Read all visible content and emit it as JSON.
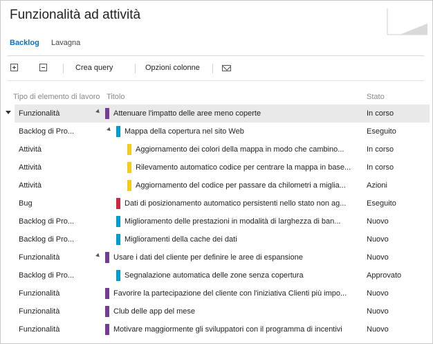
{
  "header": {
    "title": "Funzionalità ad attività"
  },
  "tabs": [
    {
      "label": "Backlog",
      "active": true
    },
    {
      "label": "Lavagna",
      "active": false
    }
  ],
  "toolbar": {
    "expand_icon": "expand-all-icon",
    "collapse_icon": "collapse-all-icon",
    "create_query": "Crea query",
    "column_options": "Opzioni colonne",
    "mail_icon": "mail-icon"
  },
  "columns": {
    "type": "Tipo di elemento di lavoro",
    "title": "Titolo",
    "state": "Stato"
  },
  "colors": {
    "feature": "#773b93",
    "pbi": "#009ccc",
    "task": "#f2cb1d",
    "bug": "#cc293d",
    "accent": "#106ebe"
  },
  "rows": [
    {
      "type": "Funzionalità",
      "title": "Attenuare l'impatto delle aree meno coperte",
      "state": "In corso",
      "kind": "feature",
      "level": 0,
      "expanded": true,
      "selected": true
    },
    {
      "type": "Backlog di Pro...",
      "title": "Mappa della copertura nel sito Web",
      "state": "Eseguito",
      "kind": "pbi",
      "level": 1,
      "expanded": true
    },
    {
      "type": "Attività",
      "title": "Aggiornamento dei colori della mappa in modo che cambino...",
      "state": "In corso",
      "kind": "task",
      "level": 2
    },
    {
      "type": "Attività",
      "title": "Rilevamento automatico codice per centrare la mappa in base...",
      "state": "In corso",
      "kind": "task",
      "level": 2
    },
    {
      "type": "Attività",
      "title": "Aggiornamento del codice per passare da chilometri a miglia...",
      "state": "Azioni",
      "kind": "task",
      "level": 2
    },
    {
      "type": "Bug",
      "title": "Dati di posizionamento automatico persistenti nello stato non ag...",
      "state": "Eseguito",
      "kind": "bug",
      "level": 1
    },
    {
      "type": "Backlog di Pro...",
      "title": "Miglioramento delle prestazioni in modalità di larghezza di ban...",
      "state": "Nuovo",
      "kind": "pbi",
      "level": 1
    },
    {
      "type": "Backlog di Pro...",
      "title": "Miglioramenti della cache dei dati",
      "state": "Nuovo",
      "kind": "pbi",
      "level": 1
    },
    {
      "type": "Funzionalità",
      "title": "Usare i dati del cliente per definire le aree di espansione",
      "state": "Nuovo",
      "kind": "feature",
      "level": 0,
      "expanded": true
    },
    {
      "type": "Backlog di Pro...",
      "title": "Segnalazione automatica delle zone senza copertura",
      "state": "Approvato",
      "kind": "pbi",
      "level": 1
    },
    {
      "type": "Funzionalità",
      "title": "Favorire la partecipazione del cliente con l'iniziativa Clienti più impo...",
      "state": "Nuovo",
      "kind": "feature",
      "level": 0
    },
    {
      "type": "Funzionalità",
      "title": "Club delle app del mese",
      "state": "Nuovo",
      "kind": "feature",
      "level": 0
    },
    {
      "type": "Funzionalità",
      "title": "Motivare maggiormente gli sviluppatori con il programma di incentivi",
      "state": "Nuovo",
      "kind": "feature",
      "level": 0
    }
  ]
}
